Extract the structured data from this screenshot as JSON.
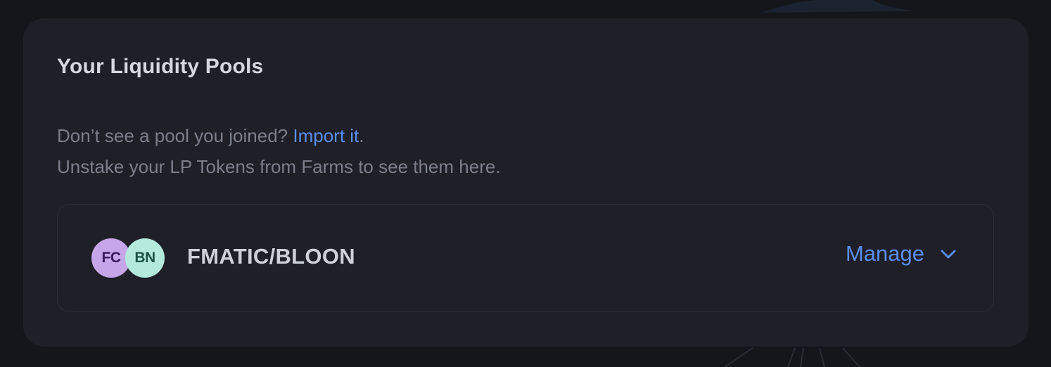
{
  "panel": {
    "title": "Your Liquidity Pools"
  },
  "info": {
    "question": "Don’t see a pool you joined? ",
    "import_link": "Import it",
    "period": ".",
    "unstake_note": "Unstake your LP Tokens from Farms to see them here."
  },
  "pools": [
    {
      "token_a": {
        "symbol": "FC",
        "color": "#c6a6e8"
      },
      "token_b": {
        "symbol": "BN",
        "color": "#b3eadb"
      },
      "pair_label": "FMATIC/BLOON",
      "manage_label": "Manage",
      "manage_icon": "chevron-down-icon"
    }
  ],
  "colors": {
    "accent": "#5b8def",
    "panel_bg": "#1e1f27",
    "page_bg": "#15161b"
  }
}
